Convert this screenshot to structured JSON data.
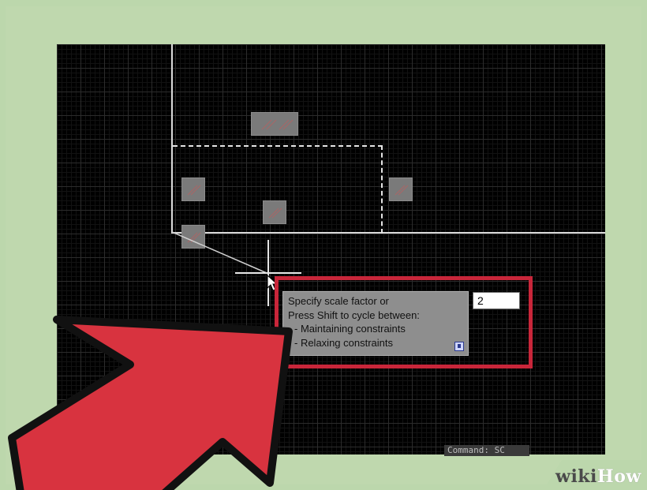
{
  "prompt": {
    "lines": [
      "Specify scale factor or",
      "Press Shift to cycle between:",
      "- Maintaining constraints",
      "- Relaxing constraints"
    ],
    "input_value": "2"
  },
  "command_line": {
    "text": "Command: SC"
  },
  "watermark": {
    "part1": "wiki",
    "part2": "How"
  },
  "colors": {
    "background_green": "#bcd7ac",
    "canvas": "#000000",
    "grid": "#2c2c2c",
    "grip": "#7a7a7a",
    "highlight_red": "#c8263a",
    "arrow_red": "#d8333f",
    "tooltip": "#8e8e8e"
  },
  "icons": [
    "crosshair-cursor-icon",
    "info-icon",
    "pointer-arrow-icon"
  ]
}
